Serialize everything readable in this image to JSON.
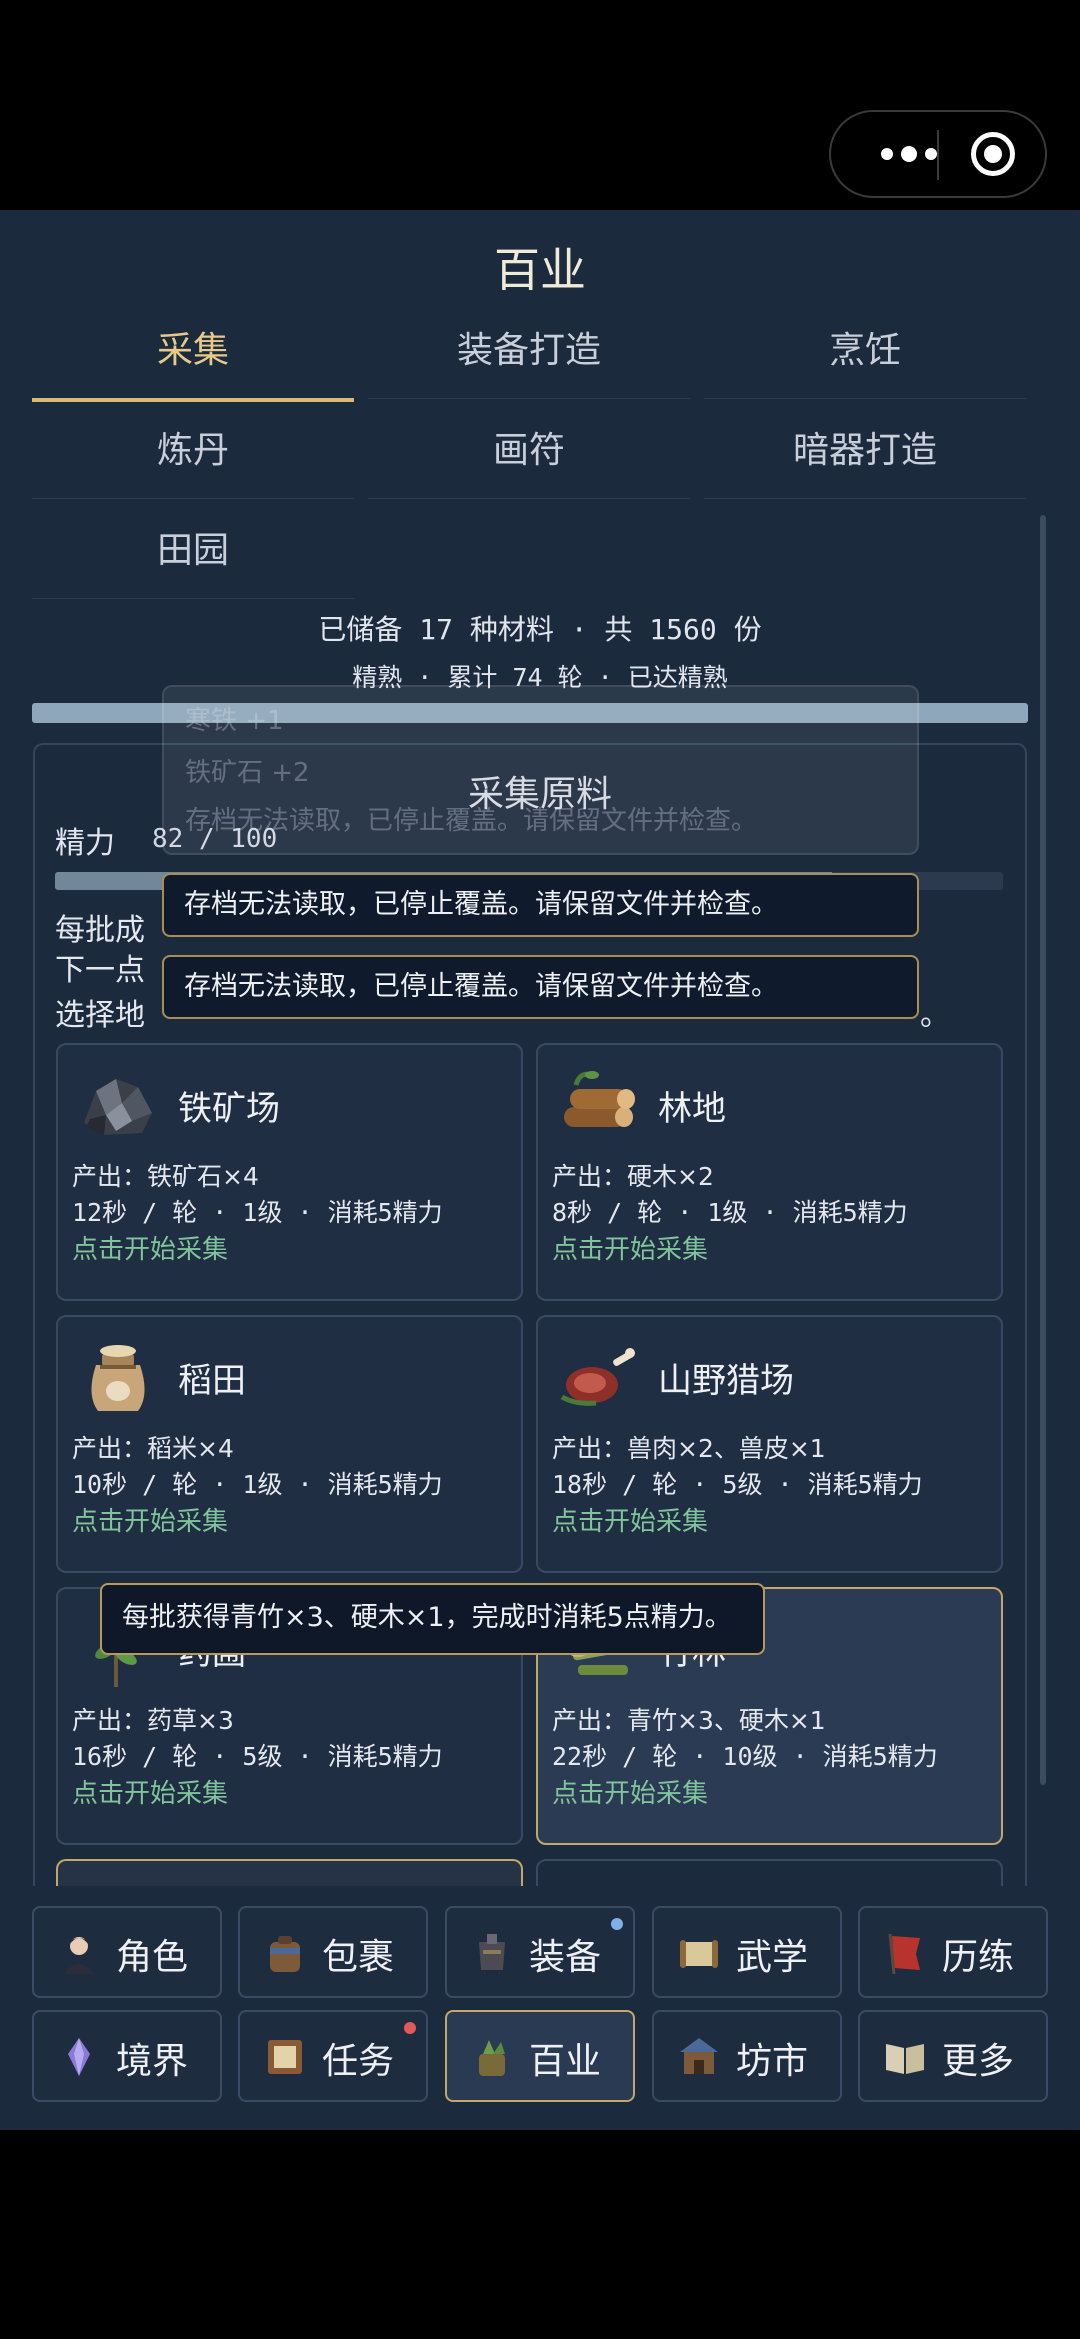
{
  "page": {
    "title": "百业"
  },
  "tabs": [
    "采集",
    "装备打造",
    "烹饪",
    "炼丹",
    "画符",
    "暗器打造",
    "田园"
  ],
  "summary": {
    "line1": "已储备 17 种材料 · 共 1560 份",
    "line2": "精熟 · 累计 74 轮 · 已达精熟",
    "progress": 1.0
  },
  "ghost_notes": [
    "寒铁 +1",
    "铁矿石 +2",
    "存档无法读取，已停止覆盖。请保留文件并检查。"
  ],
  "panel": {
    "title": "采集原料",
    "energy_label": "精力",
    "energy_value": "82 / 100",
    "energy_fraction": 0.82,
    "info_line1": "每批成",
    "info_line2": "下一点",
    "info_line3": "选择地",
    "info_line3_tail": "。"
  },
  "toasts": [
    "存档无法读取，已停止覆盖。请保留文件并检查。",
    "存档无法读取，已停止覆盖。请保留文件并检查。"
  ],
  "cards": [
    {
      "name": "铁矿场",
      "output": "产出：铁矿石×4",
      "meta": "12秒 / 轮 · 1级 · 消耗5精力",
      "action": "点击开始采集"
    },
    {
      "name": "林地",
      "output": "产出：硬木×2",
      "meta": "8秒 / 轮 · 1级 · 消耗5精力",
      "action": "点击开始采集"
    },
    {
      "name": "稻田",
      "output": "产出：稻米×4",
      "meta": "10秒 / 轮 · 1级 · 消耗5精力",
      "action": "点击开始采集"
    },
    {
      "name": "山野猎场",
      "output": "产出：兽肉×2、兽皮×1",
      "meta": "18秒 / 轮 · 5级 · 消耗5精力",
      "action": "点击开始采集"
    },
    {
      "name": "药圃",
      "output": "产出：药草×3",
      "meta": "16秒 / 轮 · 5级 · 消耗5精力",
      "action": "点击开始采集"
    },
    {
      "name": "竹林",
      "output": "产出：青竹×3、硬木×1",
      "meta": "22秒 / 轮 · 10级 · 消耗5精力",
      "action": "点击开始采集"
    }
  ],
  "tooltip": "每批获得青竹×3、硬木×1，完成时消耗5点精力。",
  "nav": [
    {
      "label": "角色",
      "icon": "character-icon"
    },
    {
      "label": "包裹",
      "icon": "bag-icon"
    },
    {
      "label": "装备",
      "icon": "armor-icon",
      "badge": "#7fb0e8"
    },
    {
      "label": "武学",
      "icon": "scroll-icon"
    },
    {
      "label": "历练",
      "icon": "banner-icon"
    },
    {
      "label": "境界",
      "icon": "crystal-icon"
    },
    {
      "label": "任务",
      "icon": "quest-board-icon",
      "badge": "#e05a5a"
    },
    {
      "label": "百业",
      "icon": "crafting-icon",
      "active": true
    },
    {
      "label": "坊市",
      "icon": "market-icon"
    },
    {
      "label": "更多",
      "icon": "book-icon"
    }
  ]
}
